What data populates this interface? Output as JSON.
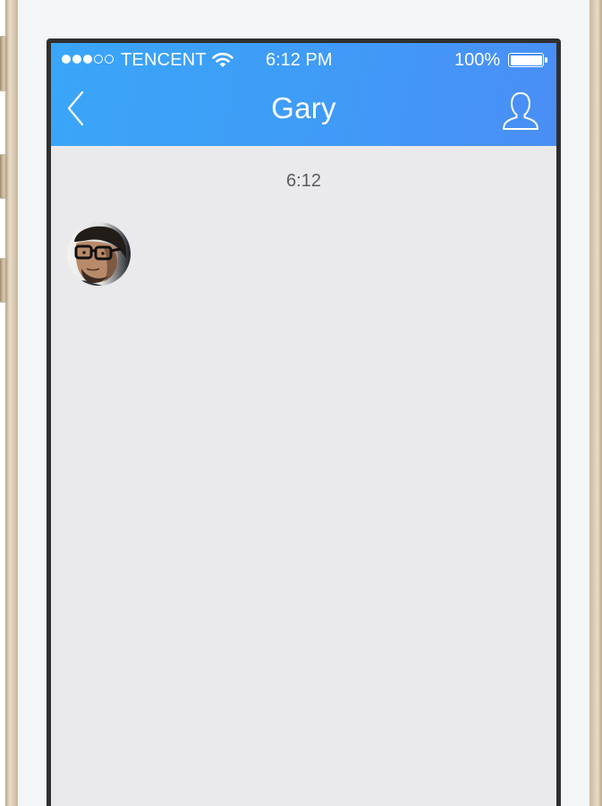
{
  "status_bar": {
    "signal": {
      "bars_filled": 3,
      "bars_total": 5
    },
    "carrier": "TENCENT",
    "wifi_icon": "wifi-icon",
    "time": "6:12 PM",
    "battery_percent": "100%",
    "battery_level": 1.0
  },
  "nav": {
    "back_icon": "chevron-left-icon",
    "title": "Gary",
    "profile_icon": "user-icon"
  },
  "chat": {
    "timestamp": "6:12",
    "messages": [
      {
        "sender": "Gary",
        "avatar": "avatar",
        "text": ""
      }
    ]
  },
  "colors": {
    "header_start": "#3aa6f8",
    "header_end": "#4a8ef5",
    "chat_background": "#eae9ec",
    "device_frame": "#d8c8b0"
  }
}
